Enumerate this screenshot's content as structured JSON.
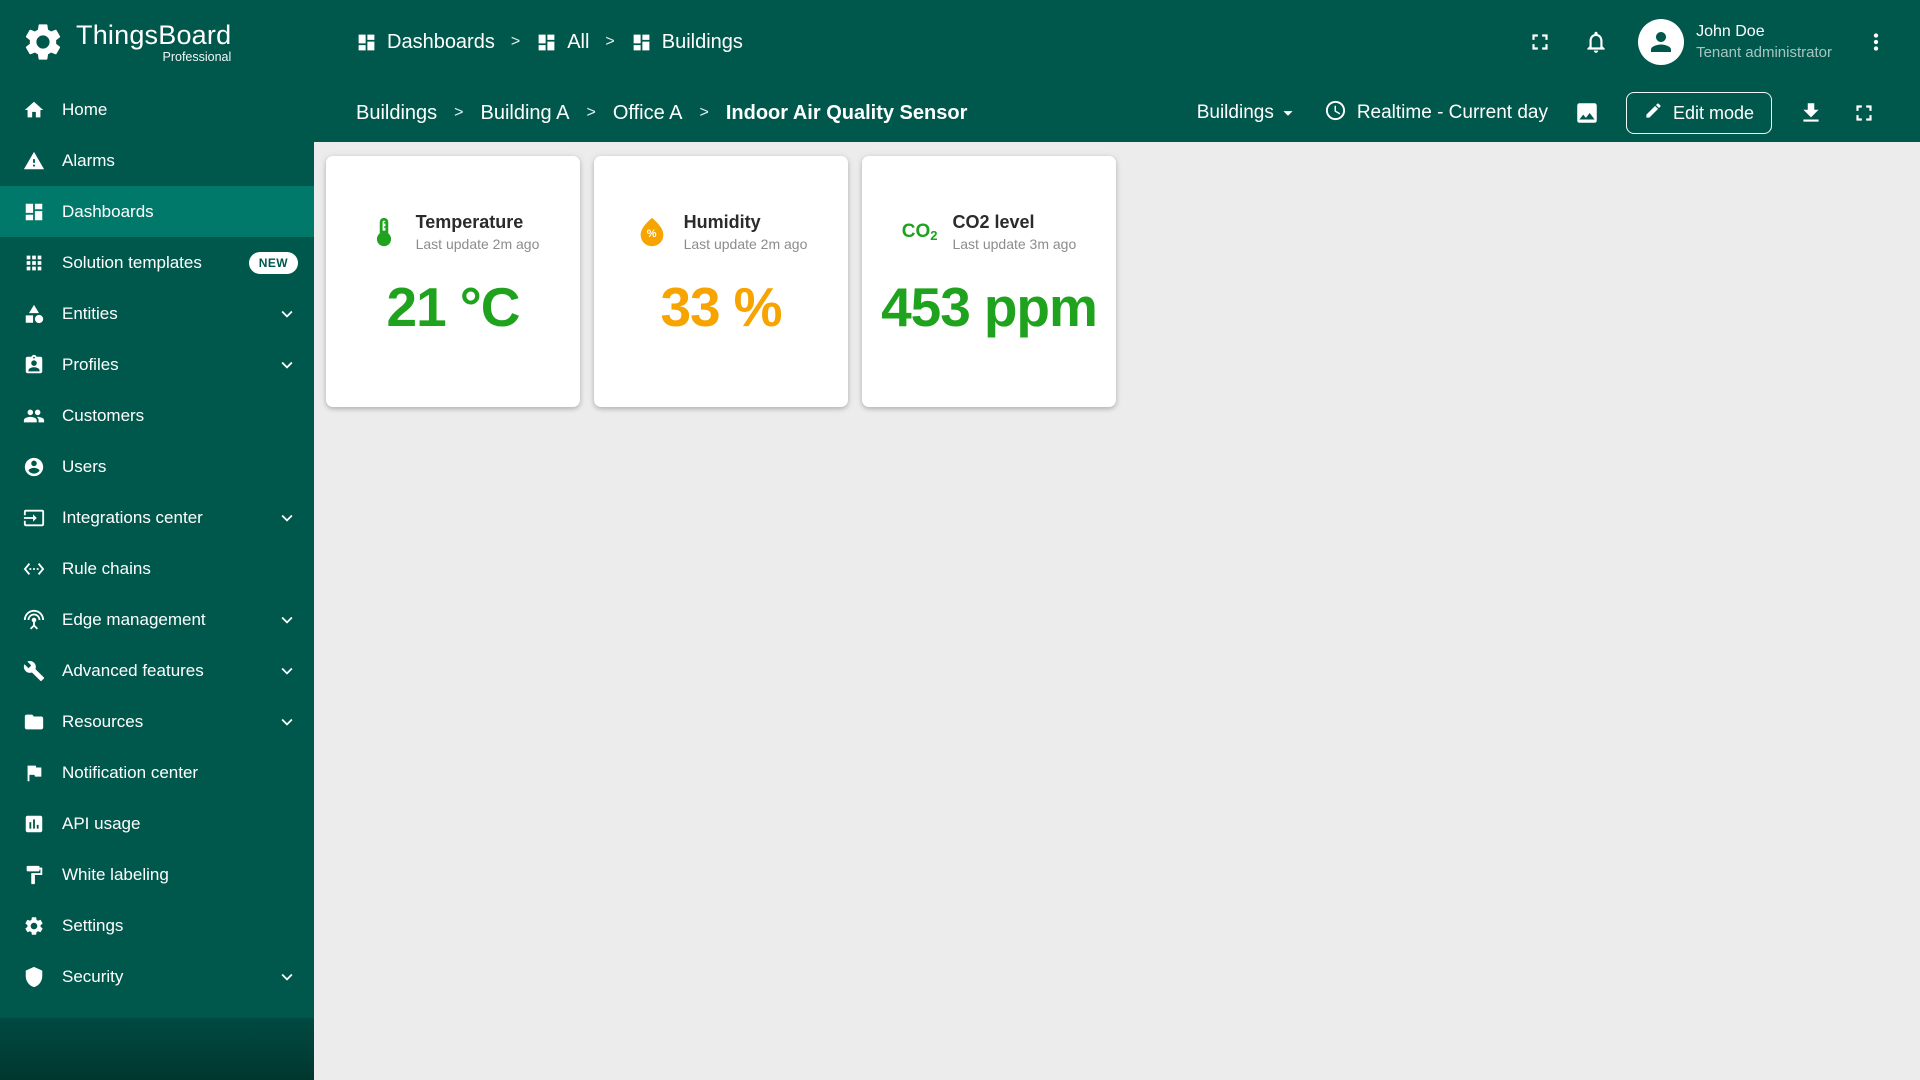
{
  "brand": {
    "name": "ThingsBoard",
    "edition": "Professional"
  },
  "colors": {
    "sidebar": "#00584D",
    "active_item": "#00796B",
    "content_bg": "#ECECEC",
    "green": "#1FA21E",
    "orange": "#F7A300"
  },
  "sidebar": {
    "items": [
      {
        "label": "Home",
        "icon": "home-icon"
      },
      {
        "label": "Alarms",
        "icon": "alarm-warning-icon"
      },
      {
        "label": "Dashboards",
        "icon": "dashboards-icon",
        "active": true
      },
      {
        "label": "Solution templates",
        "icon": "solution-templates-icon",
        "badge": "NEW"
      },
      {
        "label": "Entities",
        "icon": "entities-icon",
        "expandable": true
      },
      {
        "label": "Profiles",
        "icon": "profiles-icon",
        "expandable": true
      },
      {
        "label": "Customers",
        "icon": "customers-icon"
      },
      {
        "label": "Users",
        "icon": "users-icon"
      },
      {
        "label": "Integrations center",
        "icon": "integrations-icon",
        "expandable": true
      },
      {
        "label": "Rule chains",
        "icon": "rule-chains-icon"
      },
      {
        "label": "Edge management",
        "icon": "edge-management-icon",
        "expandable": true
      },
      {
        "label": "Advanced features",
        "icon": "advanced-features-icon",
        "expandable": true
      },
      {
        "label": "Resources",
        "icon": "resources-icon",
        "expandable": true
      },
      {
        "label": "Notification center",
        "icon": "notification-center-icon"
      },
      {
        "label": "API usage",
        "icon": "api-usage-icon"
      },
      {
        "label": "White labeling",
        "icon": "white-labeling-icon"
      },
      {
        "label": "Settings",
        "icon": "settings-icon"
      },
      {
        "label": "Security",
        "icon": "security-icon",
        "expandable": true
      }
    ]
  },
  "topbar": {
    "breadcrumbs": [
      {
        "label": "Dashboards",
        "icon": "dashboards-icon"
      },
      {
        "label": "All",
        "icon": "dashboards-icon"
      },
      {
        "label": "Buildings",
        "icon": "dashboards-icon"
      }
    ],
    "icons": [
      "fullscreen-icon",
      "notifications-bell-icon",
      "avatar-person-icon",
      "kebab-menu-icon"
    ],
    "user": {
      "name": "John Doe",
      "role": "Tenant administrator"
    }
  },
  "toolbar": {
    "breadcrumbs": [
      "Buildings",
      "Building A",
      "Office A",
      "Indoor Air Quality Sensor"
    ],
    "state_select_label": "Buildings",
    "timewindow_label": "Realtime - Current day",
    "edit_button_label": "Edit mode",
    "icons": [
      "dropdown-arrow-icon",
      "clock-icon",
      "image-icon",
      "edit-pencil-icon",
      "download-icon",
      "fullscreen-icon"
    ]
  },
  "misc": {
    "separator": ">"
  },
  "cards": [
    {
      "title": "Temperature",
      "subtitle": "Last update 2m ago",
      "value": "21",
      "unit": "°C",
      "color": "#1FA21E",
      "icon": "thermometer-icon"
    },
    {
      "title": "Humidity",
      "subtitle": "Last update 2m ago",
      "value": "33",
      "unit": "%",
      "color": "#F7A300",
      "icon": "water-drop-icon",
      "icon_symbol": "%"
    },
    {
      "title": "CO2 level",
      "subtitle": "Last update 3m ago",
      "value": "453",
      "unit": "ppm",
      "color": "#1FA21E",
      "icon": "co2-text-icon",
      "icon_main": "CO",
      "icon_sub": "2"
    }
  ]
}
